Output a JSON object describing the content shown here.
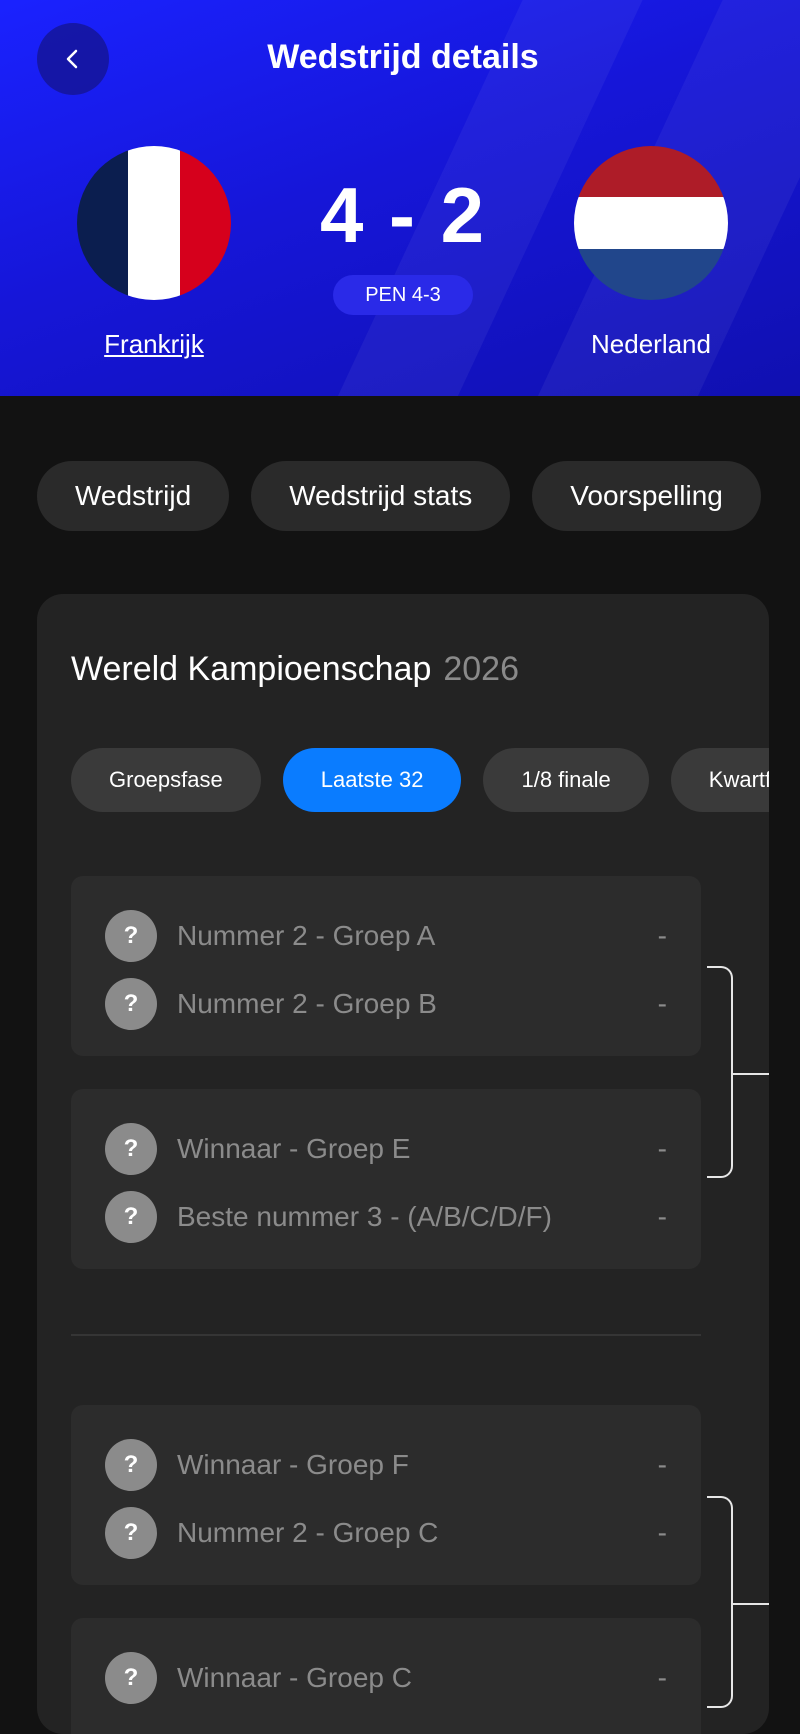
{
  "header": {
    "title": "Wedstrijd details",
    "home_team": "Frankrijk",
    "away_team": "Nederland",
    "score": "4 - 2",
    "penalties": "PEN 4-3",
    "colors": {
      "background": "#1a1ae0",
      "france": [
        "#0b1e4f",
        "#ffffff",
        "#d6001c"
      ],
      "netherlands": [
        "#ae1c28",
        "#ffffff",
        "#21468b"
      ]
    }
  },
  "tabs": [
    "Wedstrijd",
    "Wedstrijd stats",
    "Voorspelling"
  ],
  "card": {
    "title": "Wereld Kampioenschap",
    "year": "2026",
    "rounds": [
      "Groepsfase",
      "Laatste 32",
      "1/8 finale",
      "Kwartfinale"
    ],
    "active_round": "Laatste 32",
    "accent": "#0a7cff",
    "matches": [
      [
        {
          "team": "Nummer 2 - Groep A",
          "result": "-"
        },
        {
          "team": "Nummer 2 - Groep B",
          "result": "-"
        }
      ],
      [
        {
          "team": "Winnaar - Groep E",
          "result": "-"
        },
        {
          "team": "Beste nummer 3 - (A/B/C/D/F)",
          "result": "-"
        }
      ],
      [
        {
          "team": "Winnaar - Groep F",
          "result": "-"
        },
        {
          "team": "Nummer 2 - Groep C",
          "result": "-"
        }
      ],
      [
        {
          "team": "Winnaar - Groep C",
          "result": "-"
        },
        {
          "team": "",
          "result": ""
        }
      ]
    ],
    "unknown_team_icon": "question-mark-icon"
  }
}
